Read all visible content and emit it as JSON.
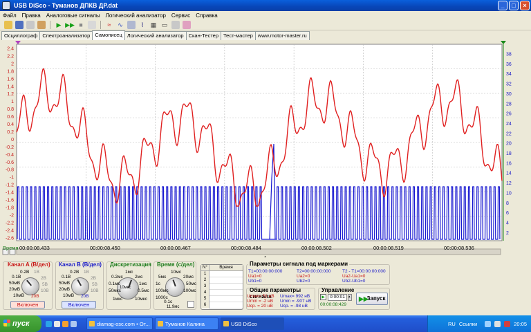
{
  "window": {
    "title": "USB DiSco - Туманов ДПКВ ДР.dat"
  },
  "menu": [
    "Файл",
    "Правка",
    "Аналоговые сигналы",
    "Логический анализатор",
    "Сервис",
    "Справка"
  ],
  "toolbar_icons": [
    "open-icon",
    "save-icon",
    "print-icon",
    "chart-icon",
    "play-icon",
    "play-step-icon",
    "stop-icon",
    "single-icon",
    "trigger-icon",
    "wave-icon",
    "meter-icon",
    "tune-icon",
    "bar-icon",
    "zoom-icon",
    "calc-icon",
    "eraser-icon"
  ],
  "tabs": [
    {
      "label": "Осциллограф",
      "active": false
    },
    {
      "label": "Спектроанализатор",
      "active": false
    },
    {
      "label": "Самописец",
      "active": true
    },
    {
      "label": "Логический анализатор",
      "active": false
    },
    {
      "label": "Скан-Тестер",
      "active": false
    },
    {
      "label": "Тест-мастер",
      "active": false
    },
    {
      "label": "www.motor-master.ru",
      "active": false
    }
  ],
  "plot": {
    "left_axis_ticks": [
      "2.4",
      "2.2",
      "2",
      "1.8",
      "1.6",
      "1.4",
      "1.2",
      "1",
      "0.8",
      "0.6",
      "0.4",
      "0.2",
      "0",
      "-0.2",
      "-0.4",
      "-0.6",
      "-0.8",
      "-1",
      "-1.2",
      "-1.4",
      "-1.6",
      "-1.8",
      "-2",
      "-2.2",
      "-2.4",
      "-2.6"
    ],
    "right_axis_ticks": [
      "38",
      "36",
      "34",
      "32",
      "30",
      "28",
      "26",
      "24",
      "22",
      "20",
      "18",
      "16",
      "14",
      "12",
      "10",
      "8",
      "6",
      "4",
      "2"
    ],
    "time_axis_label": "Время",
    "time_ticks": [
      "00:00:08.433",
      "00:00:08.450",
      "00:00:08.467",
      "00:00:08.484",
      "00:00:08.502",
      "00:00:08.519",
      "00:00:08.536"
    ],
    "colors": {
      "channel_a": "#E02020",
      "channel_b": "#1818D0",
      "background": "#FFFFFF",
      "grid": "#B8B8B8"
    }
  },
  "panel": {
    "channel_a": {
      "title": "Канал A (В/дел)",
      "button": "Включен",
      "labels": [
        "0.2В",
        "0.1В",
        "50мВ",
        "20мВ",
        "10мВ",
        "1В",
        "2В",
        "5В",
        "10В",
        "20В"
      ]
    },
    "channel_b": {
      "title": "Канал B (В/дел)",
      "button": "Включен",
      "labels": [
        "0.2В",
        "0.1В",
        "50мВ",
        "20мВ",
        "10мВ",
        "1В",
        "2В",
        "5В",
        "10В",
        "20В"
      ]
    },
    "discretization": {
      "title": "Дискретизация",
      "labels": [
        "1мс",
        "0.2мс",
        "0.1мс",
        "50мкс",
        "10мкс",
        "1мкс",
        "2мс",
        "1мс",
        "0.5мс",
        "10мкс"
      ]
    },
    "time_div": {
      "title": "Время (с/дел)",
      "labels": [
        "10мс",
        "5мс",
        "1с",
        "100мс",
        "1000с",
        "0.1с",
        "20мс",
        "50мс",
        "100мс",
        "11.9мс"
      ]
    },
    "table": {
      "headers": [
        "N°",
        "Время"
      ],
      "rows": [
        "1",
        "2",
        "3",
        "4",
        "5",
        "6"
      ]
    },
    "markers": {
      "title": "Параметры сигнала под маркерами",
      "t1": "T1=00:00:00:000",
      "t2": "T2=00:00:00:000",
      "dt": "T2 - T1=00:00:00:000",
      "ua1": "Ua1=0",
      "ua2": "Ua2=0",
      "dua": "Ua2-Ua1=0",
      "ub1": "Ub1=0",
      "ub2": "Ub2=0",
      "dub": "Ub2-Ub1=0"
    },
    "general": {
      "title": "Общие параметры сигнала",
      "a": [
        "Umax= 51 нВ",
        "Umin = -2 нВ",
        "Ucp. = 20 нВ"
      ],
      "b": [
        "Umax= 992 нВ",
        "Umin = -907 нВ",
        "Ucp. = -98 нВ"
      ]
    },
    "control": {
      "title": "Управление",
      "counter": "0:00:01",
      "timestamp": "00:00:08:429",
      "start_button": "Запуск"
    }
  },
  "taskbar": {
    "start": "пуск",
    "tasks": [
      "diamag-osc.com • От...",
      "Туманов Калина",
      "USB DiSco"
    ],
    "lang": "RU",
    "links": "Ссылки",
    "clock": "20:05"
  }
}
